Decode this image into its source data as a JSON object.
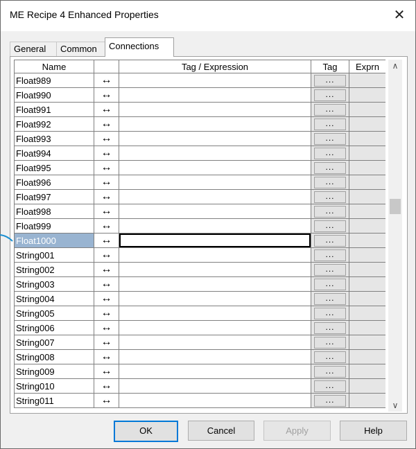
{
  "window": {
    "title": "ME Recipe 4 Enhanced Properties",
    "close_glyph": "✕"
  },
  "tabs": [
    {
      "label": "General"
    },
    {
      "label": "Common"
    },
    {
      "label": "Connections"
    }
  ],
  "grid": {
    "headers": {
      "name": "Name",
      "tag_expression": "Tag / Expression",
      "tag": "Tag",
      "exprn": "Exprn"
    },
    "arrow_glyph": "↔",
    "tag_button_label": "...",
    "rows": [
      {
        "name": "Float989"
      },
      {
        "name": "Float990"
      },
      {
        "name": "Float991"
      },
      {
        "name": "Float992"
      },
      {
        "name": "Float993"
      },
      {
        "name": "Float994"
      },
      {
        "name": "Float995"
      },
      {
        "name": "Float996"
      },
      {
        "name": "Float997"
      },
      {
        "name": "Float998"
      },
      {
        "name": "Float999"
      },
      {
        "name": "Float1000",
        "selected": true
      },
      {
        "name": "String001"
      },
      {
        "name": "String002"
      },
      {
        "name": "String003"
      },
      {
        "name": "String004"
      },
      {
        "name": "String005"
      },
      {
        "name": "String006"
      },
      {
        "name": "String007"
      },
      {
        "name": "String008"
      },
      {
        "name": "String009"
      },
      {
        "name": "String010"
      },
      {
        "name": "String011"
      }
    ]
  },
  "scrollbar": {
    "up_glyph": "∧",
    "down_glyph": "∨"
  },
  "buttons": {
    "ok": "OK",
    "cancel": "Cancel",
    "apply": "Apply",
    "help": "Help"
  },
  "colors": {
    "selection": "#99b4d1",
    "pointer_line": "#1a8fd1",
    "default_button_border": "#0078d7"
  }
}
